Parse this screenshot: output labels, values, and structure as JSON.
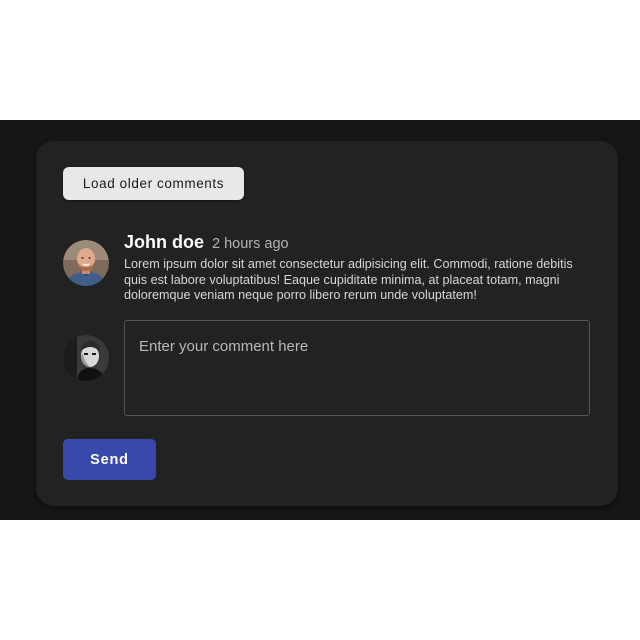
{
  "comments": {
    "load_older_label": "Load older comments",
    "items": [
      {
        "author": "John doe",
        "time": "2 hours ago",
        "text": "Lorem ipsum dolor sit amet consectetur adipisicing elit. Commodi, ratione debitis quis est labore voluptatibus! Eaque cupiditate minima, at placeat totam, magni doloremque veniam neque porro libero rerum unde voluptatem!",
        "avatar_icon": "user-avatar-photo"
      }
    ]
  },
  "composer": {
    "avatar_icon": "current-user-avatar-photo",
    "placeholder": "Enter your comment here",
    "value": "",
    "send_label": "Send"
  },
  "colors": {
    "page_background": "#161616",
    "card_background": "#222222",
    "accent": "#3949ab",
    "secondary_button": "#e8e8e8"
  }
}
